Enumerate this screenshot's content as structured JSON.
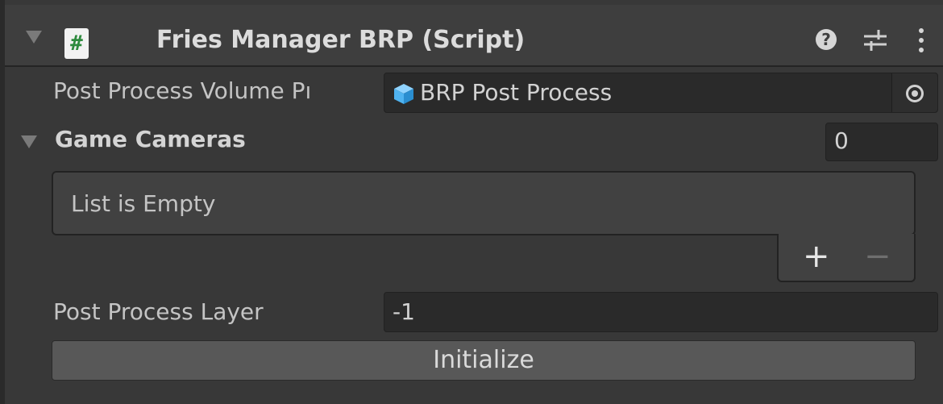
{
  "component": {
    "title": "Fries Manager BRP (Script)",
    "script_icon_glyph": "#",
    "icons": [
      "foldout-arrow-icon",
      "script-icon",
      "help-icon",
      "preset-settings-icon",
      "context-menu-icon"
    ]
  },
  "fields": {
    "post_process_volume": {
      "label": "Post Process Volume Pı",
      "value": "BRP Post Process",
      "icon": "gameobject-cube-icon"
    },
    "game_cameras": {
      "label": "Game Cameras",
      "count": "0",
      "empty_text": "List is Empty",
      "add_label": "+",
      "remove_label": "−"
    },
    "post_process_layer": {
      "label": "Post Process Layer",
      "value": "-1"
    }
  },
  "actions": {
    "initialize_label": "Initialize"
  },
  "colors": {
    "background": "#383838",
    "field": "#2a2a2a",
    "button": "#585858",
    "cube_icon": "#4fb3f0"
  }
}
